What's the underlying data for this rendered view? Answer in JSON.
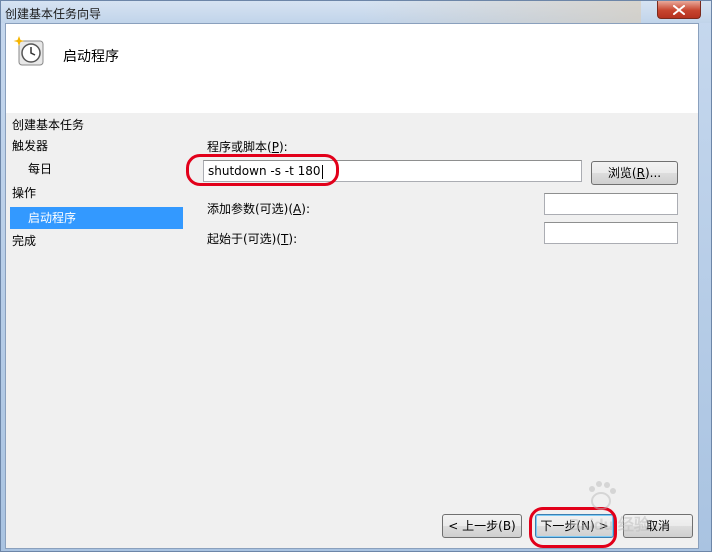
{
  "window": {
    "title": "创建基本任务向导"
  },
  "header": {
    "title": "启动程序",
    "icon": "clock-sparkle-icon"
  },
  "steps": {
    "section_label": "创建基本任务",
    "items": [
      {
        "label": "触发器",
        "level": 0,
        "selected": false
      },
      {
        "label": "每日",
        "level": 1,
        "selected": false
      },
      {
        "label": "操作",
        "level": 0,
        "selected": false
      },
      {
        "label": "启动程序",
        "level": 1,
        "selected": true
      },
      {
        "label": "完成",
        "level": 0,
        "selected": false
      }
    ]
  },
  "form": {
    "program_label_prefix": "程序或脚本(",
    "program_label_key": "P",
    "program_label_suffix": "):",
    "program_value": "shutdown -s -t 180",
    "browse_prefix": "浏览(",
    "browse_key": "R",
    "browse_suffix": ")...",
    "args_prefix": "添加参数(可选)(",
    "args_key": "A",
    "args_suffix": "):",
    "args_value": "",
    "start_in_prefix": "起始于(可选)(",
    "start_in_key": "T",
    "start_in_suffix": "):",
    "start_in_value": ""
  },
  "footer": {
    "back_label": "< 上一步(B)",
    "next_label": "下一步(N) >",
    "cancel_label": "取消"
  },
  "watermark": {
    "text": "Baidu 经验"
  },
  "colors": {
    "selection": "#3399ff",
    "annotation_red": "#e2001a"
  }
}
